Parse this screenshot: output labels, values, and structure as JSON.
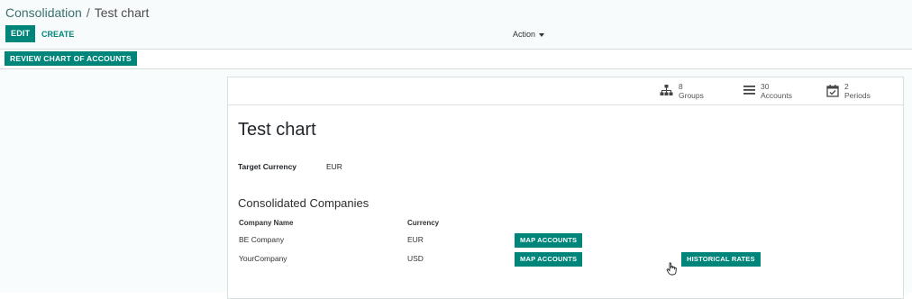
{
  "breadcrumb": {
    "parent": "Consolidation",
    "separator": "/",
    "current": "Test chart"
  },
  "control_panel": {
    "edit_label": "EDIT",
    "create_label": "CREATE",
    "action_label": "Action"
  },
  "statusbar": {
    "review_label": "REVIEW CHART OF ACCOUNTS"
  },
  "stats": [
    {
      "icon": "sitemap-icon",
      "count": "8",
      "label": "Groups"
    },
    {
      "icon": "list-icon",
      "count": "30",
      "label": "Accounts"
    },
    {
      "icon": "calendar-icon",
      "count": "2",
      "label": "Periods"
    }
  ],
  "form": {
    "title": "Test chart",
    "target_currency_label": "Target Currency",
    "target_currency_value": "EUR",
    "section_title": "Consolidated Companies",
    "columns": [
      "Company Name",
      "Currency"
    ],
    "rows": [
      {
        "company": "BE Company",
        "currency": "EUR",
        "button": "MAP ACCOUNTS"
      },
      {
        "company": "YourCompany",
        "currency": "USD",
        "button": "MAP ACCOUNTS"
      }
    ],
    "historical_rates_label": "HISTORICAL RATES"
  },
  "colors": {
    "accent": "#00857a",
    "topbar": "#f7fbfb",
    "border": "#d5dcdc"
  }
}
